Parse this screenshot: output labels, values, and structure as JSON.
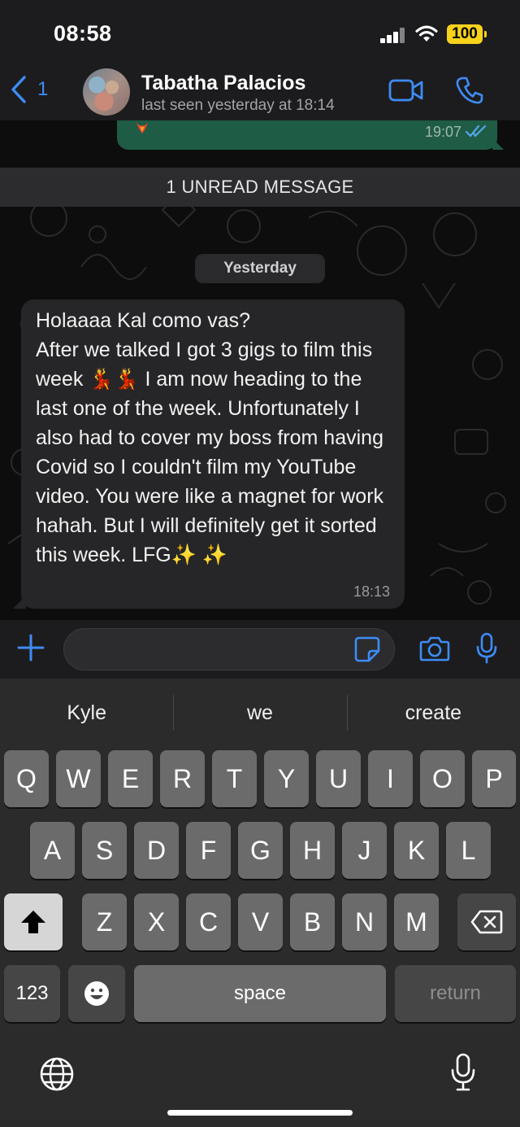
{
  "status_bar": {
    "time": "08:58",
    "battery": "100"
  },
  "header": {
    "back_count": "1",
    "contact_name": "Tabatha  Palacios",
    "last_seen": "last seen yesterday at 18:14",
    "accent_color": "#3e8cf5"
  },
  "chat": {
    "sent_message": {
      "content": "fire-emoji",
      "time": "19:07",
      "status": "read"
    },
    "unread_banner": "1 UNREAD MESSAGE",
    "date_separator": "Yesterday",
    "received_message": {
      "text": "Holaaaa Kal como vas?\nAfter we talked I got 3 gigs to film this week 💃💃 I am now heading to the last one of the week. Unfortunately I also had to cover my boss from having Covid so I couldn't film my YouTube video. You were like a magnet for work hahah. But I will definitely get it sorted this week. LFG✨ ✨",
      "time": "18:13"
    }
  },
  "input_bar": {
    "placeholder": ""
  },
  "keyboard": {
    "suggestions": [
      "Kyle",
      "we",
      "create"
    ],
    "row1": [
      "Q",
      "W",
      "E",
      "R",
      "T",
      "Y",
      "U",
      "I",
      "O",
      "P"
    ],
    "row2": [
      "A",
      "S",
      "D",
      "F",
      "G",
      "H",
      "J",
      "K",
      "L"
    ],
    "row3": [
      "Z",
      "X",
      "C",
      "V",
      "B",
      "N",
      "M"
    ],
    "numbers_label": "123",
    "space_label": "space",
    "return_label": "return"
  }
}
